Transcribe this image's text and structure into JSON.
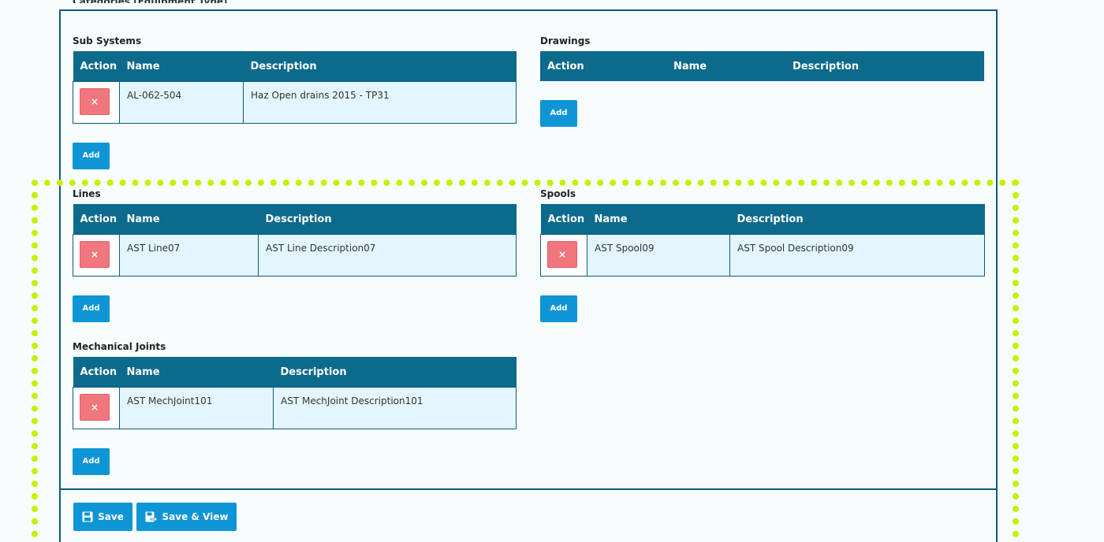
{
  "top_heading_partial": "Categories (Equipment Type)",
  "columns": {
    "action": "Action",
    "name": "Name",
    "description": "Description"
  },
  "delete_symbol": "×",
  "add_label": "Add",
  "sub_systems": {
    "title": "Sub Systems",
    "rows": [
      {
        "name": "AL-062-504",
        "description": "Haz Open drains 2015 - TP31"
      }
    ]
  },
  "drawings": {
    "title": "Drawings",
    "rows": []
  },
  "lines": {
    "title": "Lines",
    "rows": [
      {
        "name": "AST Line07",
        "description": "AST Line Description07"
      }
    ]
  },
  "spools": {
    "title": "Spools",
    "rows": [
      {
        "name": "AST Spool09",
        "description": "AST Spool Description09"
      }
    ]
  },
  "mechanical_joints": {
    "title": "Mechanical Joints",
    "rows": [
      {
        "name": "AST MechJoint101",
        "description": "AST MechJoint Description101"
      }
    ]
  },
  "footer": {
    "save_label": "Save",
    "save_view_label": "Save & View"
  },
  "colors": {
    "header_bg": "#0c6a8c",
    "row_bg": "#e4f6fd",
    "button_blue": "#0d95d6",
    "delete_red": "#f0777e",
    "highlight": "#c7f000"
  }
}
